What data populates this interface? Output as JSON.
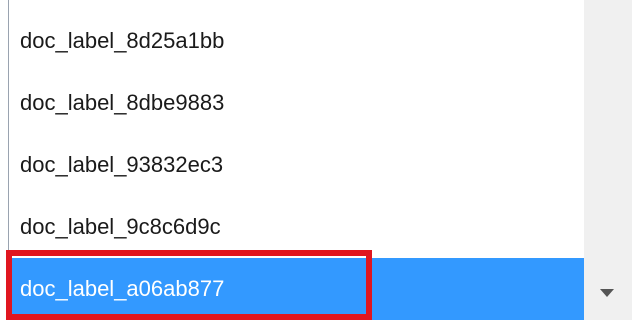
{
  "list": {
    "items": [
      {
        "label": "doc_label_8d25a1bb",
        "selected": false
      },
      {
        "label": "doc_label_8dbe9883",
        "selected": false
      },
      {
        "label": "doc_label_93832ec3",
        "selected": false
      },
      {
        "label": "doc_label_9c8c6d9c",
        "selected": false
      },
      {
        "label": "doc_label_a06ab877",
        "selected": true
      }
    ]
  },
  "icons": {
    "dropdown": "chevron-down-icon"
  },
  "colors": {
    "selection_background": "#3399ff",
    "selection_text": "#ffffff",
    "highlight_border": "#e0161f",
    "panel_border": "#9aa3b0"
  }
}
